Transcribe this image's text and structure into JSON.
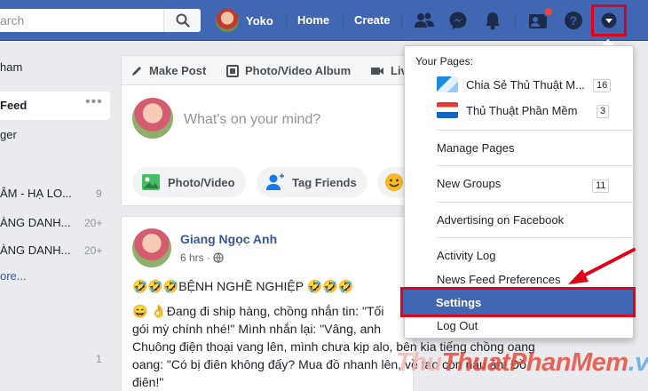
{
  "header": {
    "search_placeholder": "arch",
    "profile_name": "Yoko",
    "nav_home": "Home",
    "nav_create": "Create",
    "brand_color": "#4267b2"
  },
  "left_sidebar": {
    "items": [
      {
        "label": "ham",
        "count": ""
      },
      {
        "label": "Feed",
        "count": ""
      },
      {
        "label": "ger",
        "count": ""
      },
      {
        "label": "ÂM - HẠ LO...",
        "count": "9"
      },
      {
        "label": "ÀNG DANH...",
        "count": "20+"
      },
      {
        "label": "ÀNG DANH...",
        "count": "20+"
      },
      {
        "label": "ore...",
        "count": ""
      }
    ],
    "trailing_count": "1"
  },
  "composer": {
    "tabs": [
      "Make Post",
      "Photo/Video Album",
      "Liv"
    ],
    "placeholder": "What's on your mind?",
    "actions": [
      "Photo/Video",
      "Tag Friends"
    ]
  },
  "post": {
    "author": "Giang Ngọc Anh",
    "time": "6 hrs · ",
    "title": "🤣🤣🤣BỆNH NGHỀ NGHIỆP 🤣🤣🤣",
    "body_lines": [
      "😄 👌Đang đi ship hàng, chồng nhắn tin: \"Tối",
      "gói mỳ chính nhé!\" Mình nhắn lại: \"Vâng, anh",
      "Chuông điện thoại vang lên, mình chưa kịp alo, bên kia tiếng chồng oang",
      "oang: \"Có bị điên không đấy? Mua đồ nhanh lên, về tao còn nấu ăn! Đồ",
      "điên!\""
    ]
  },
  "menu": {
    "your_pages_label": "Your Pages:",
    "pages": [
      {
        "name": "Chia Sẻ Thủ Thuật M...",
        "count": "16"
      },
      {
        "name": "Thủ Thuật Phần Mềm",
        "count": "3"
      }
    ],
    "manage_pages": "Manage Pages",
    "new_groups": "New Groups",
    "new_groups_count": "11",
    "advertising": "Advertising on Facebook",
    "activity_log": "Activity Log",
    "news_feed_prefs": "News Feed Preferences",
    "settings": "Settings",
    "log_out": "Log Out"
  },
  "watermark": {
    "part1": "Thu",
    "part2": "Thuat",
    "part3": "PhanMem",
    "part4": ".vn"
  }
}
